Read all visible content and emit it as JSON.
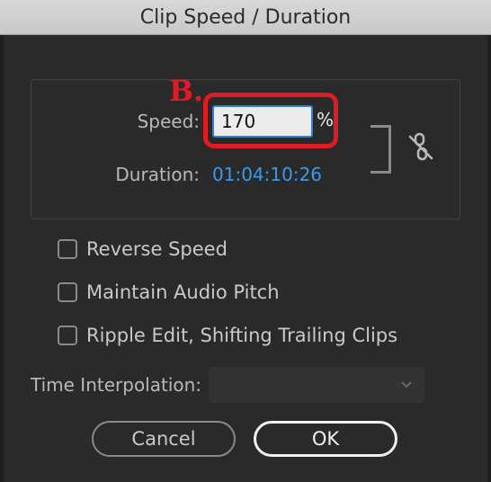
{
  "dialog": {
    "title": "Clip Speed / Duration",
    "speed_label": "Speed:",
    "speed_value": "170",
    "speed_unit": "%",
    "duration_label": "Duration:",
    "duration_value": "01:04:10:26",
    "annotation_label": "B.",
    "link_icon": "unlink-icon",
    "checkboxes": [
      {
        "label": "Reverse Speed",
        "checked": false
      },
      {
        "label": "Maintain Audio Pitch",
        "checked": false
      },
      {
        "label": "Ripple Edit, Shifting Trailing Clips",
        "checked": false
      }
    ],
    "time_interpolation_label": "Time Interpolation:",
    "time_interpolation_value": "",
    "cancel_label": "Cancel",
    "ok_label": "OK"
  },
  "colors": {
    "accent_blue": "#3d9aeb",
    "annotation_red": "#e01b24",
    "input_border": "#2f7ed8"
  }
}
